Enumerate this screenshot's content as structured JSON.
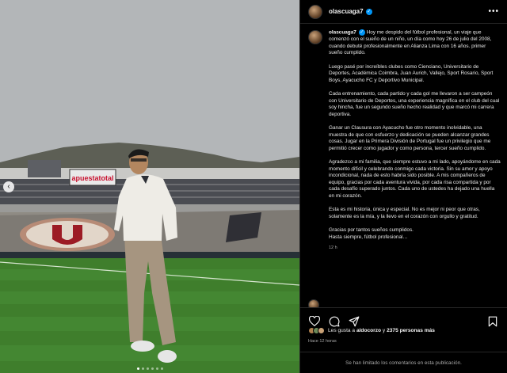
{
  "post": {
    "username": "olascuaga7",
    "menu_icon": "more-horizontal-icon",
    "caption_paragraphs": [
      "Hoy me despido del fútbol profesional, un viaje que comenzó con el sueño de un niño, un día como hoy 26 de julio del 2008, cuando debuté profesionalmente en Alianza Lima con 16 años. primer sueño cumplido.",
      "Luego pasé por increíbles clubes como Cienciano, Universitario de Deportes, Académica Coimbra, Juan Aurich, Vallejo, Sport Rosario, Sport Boys, Ayacucho FC y Deportivo Municipal.",
      "Cada entrenamiento, cada partido y cada gol me llevaron a ser campeón con Universitario de Deportes, una experiencia magnífica en el club del cual soy hincha, fue un segundo sueño hecho realidad y que marcó mi carrera deportiva.",
      "Ganar un Clausura con Ayacucho fue otro momento inolvidable, una muestra de que con esfuerzo y dedicación se pueden alcanzar grandes cosas. Jugar en la Primera División de Portugal fue un privilegio que me permitió crecer como jugador y como persona, tercer sueño cumplido.",
      "Agradezco a mi familia, que siempre estuvo a mi lado, apoyándome en cada momento difícil y celebrando conmigo cada victoria. Sin su amor y apoyo incondicional, nada de esto habría sido posible. A mis compañeros de equipo, gracias por cada aventura vivida, por cada risa compartida y por cada desafío superado juntos. Cada uno de ustedes ha dejado una huella en mi corazón.",
      "Esta es mi historia, única y especial. No es mejor ni peor que otras, solamente es la mía, y la llevo en el corazón con orgullo y gratitud."
    ],
    "caption_end_1": "Gracias por tantos sueños cumplidos.",
    "caption_end_2": "Hasta siempre, fútbol profesional…",
    "caption_time": "12 h",
    "likes_prefix": "Les gusta a",
    "likes_user": "aldocorzo",
    "likes_middle": "y",
    "likes_count": "2375 personas más",
    "posted_ago": "Hace 12 horas",
    "comments_limited": "Se han limitado los comentarios en esta publicación."
  },
  "photo": {
    "stadium_sign": "apuestatotal",
    "nav_icon": "chevron-left-icon",
    "slide_count": 6,
    "active_slide": 1
  },
  "icons": [
    "heart-icon",
    "comment-icon",
    "share-icon",
    "bookmark-icon",
    "verified-badge-icon"
  ],
  "colors": {
    "background": "#000000",
    "verified": "#0095f6",
    "muted_text": "#a8a8a8",
    "divider": "#262626"
  }
}
